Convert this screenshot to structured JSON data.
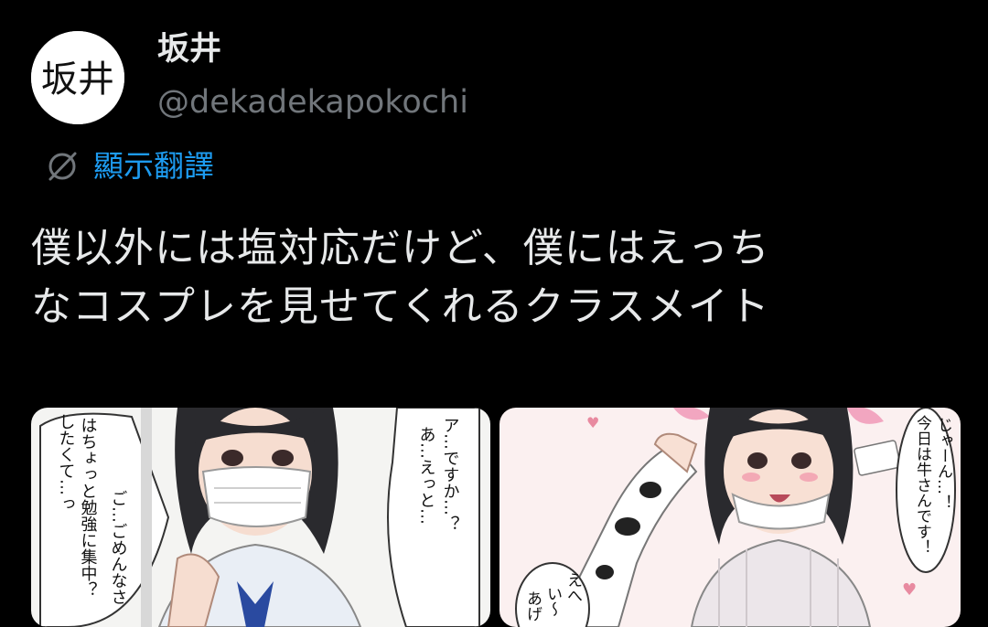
{
  "author": {
    "avatar_text": "坂井",
    "display_name": "坂井",
    "handle": "@dekadekapokochi"
  },
  "translate": {
    "label": "顯示翻譯",
    "icon": "globe-slash-icon"
  },
  "tweet": {
    "lines": [
      "僕以外には塩対応だけど、僕にはえっち",
      "なコスプレを見せてくれるクラスメイト"
    ]
  },
  "media": {
    "left": {
      "bubble_1": "ア…ですか…？",
      "bubble_2": "あ…えっと…",
      "bubble_3": "はちょっと勉強に集中？",
      "bubble_4": "したくて…っ",
      "bubble_5": "ご…ごめんなさ"
    },
    "right": {
      "bubble_1": "じゃーん…！",
      "bubble_2": "今日は牛さんです！",
      "bubble_3": "えへ",
      "bubble_4": "い～",
      "bubble_5": "あげ"
    }
  },
  "colors": {
    "background": "#000000",
    "text_primary": "#e7e9ea",
    "text_secondary": "#71767b",
    "link_blue": "#1d9bf0"
  }
}
